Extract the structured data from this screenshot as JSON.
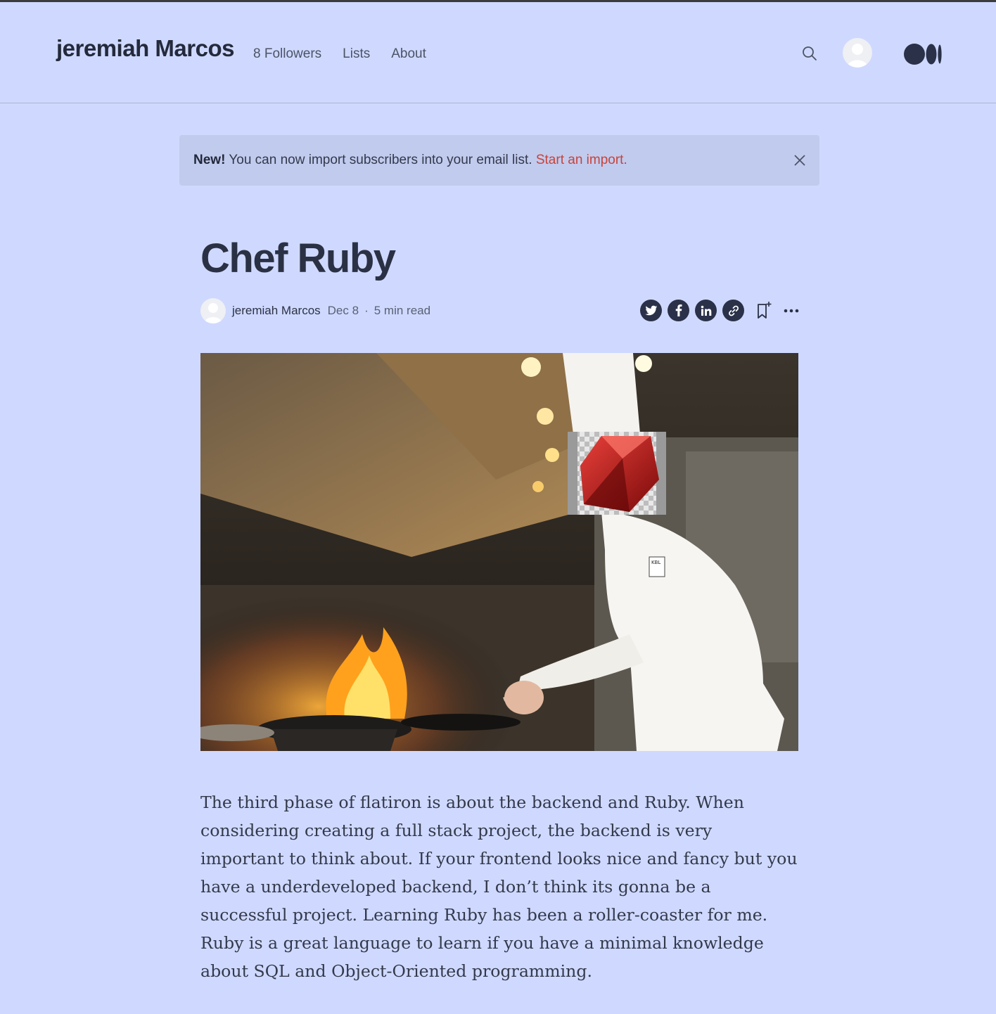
{
  "header": {
    "brand": "jeremiah Marcos",
    "nav": {
      "followers": "8 Followers",
      "lists": "Lists",
      "about": "About"
    }
  },
  "banner": {
    "label": "New!",
    "text": " You can now import subscribers into your email list. ",
    "link": "Start an import."
  },
  "article": {
    "title": "Chef Ruby",
    "author": "jeremiah Marcos",
    "date": "Dec 8",
    "separator": "·",
    "read_time": "5 min read",
    "share_icons": [
      "twitter-icon",
      "facebook-icon",
      "linkedin-icon",
      "link-icon"
    ],
    "hero_image": {
      "icons": [
        "ruby-logo",
        "chef-hat",
        "fire"
      ],
      "badge_text": "KBL"
    },
    "body": "The third phase of flatiron is about the backend and Ruby. When considering creating a full stack project, the backend is very important to think about. If your frontend looks nice and fancy but you have a underdeveloped backend, I don’t think its gonna be a successful project. Learning Ruby has been a roller-coaster for me. Ruby is a great language to learn if you have a minimal knowledge about SQL and Object-Oriented programming."
  },
  "colors": {
    "background": "#cfd9ff",
    "banner": "#c1cbee",
    "link_red": "#c8433a",
    "icon_dark": "#2a3148"
  }
}
